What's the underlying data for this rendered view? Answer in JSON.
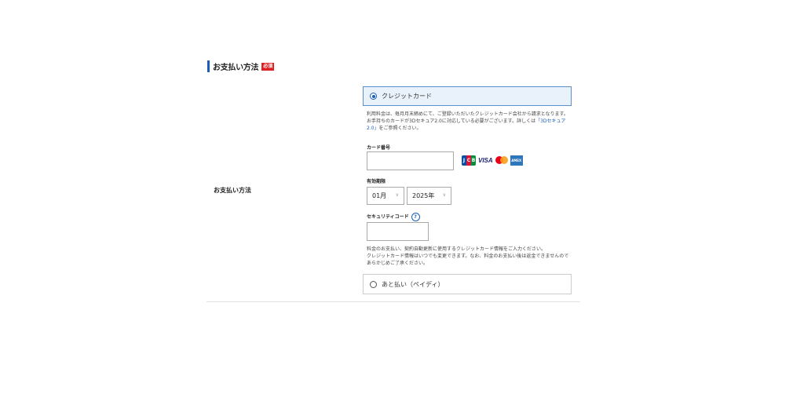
{
  "section": {
    "title": "お支払い方法",
    "required_badge": "必須"
  },
  "row_label": "お支払い方法",
  "credit_option": {
    "label": "クレジットカード",
    "selected": true
  },
  "note_top": {
    "line1": "利用料金は、毎月月末締めにて、ご登録いただいたクレジットカード会社から請求となります。",
    "line2_prefix": "お手持ちのカードが3Dセキュア2.0に対応している必要がございます。詳しくは",
    "link": "「3Dセキュア2.0」",
    "line2_suffix": "をご参照ください。"
  },
  "card_number": {
    "label": "カード番号",
    "value": "",
    "placeholder": ""
  },
  "card_brands": [
    {
      "name": "JCB",
      "icon": "jcb-icon"
    },
    {
      "name": "VISA",
      "icon": "visa-icon"
    },
    {
      "name": "Mastercard",
      "icon": "mastercard-icon"
    },
    {
      "name": "AMEX",
      "icon": "amex-icon"
    }
  ],
  "expiry": {
    "label": "有効期限",
    "month": "01月",
    "year": "2025年"
  },
  "security_code": {
    "label": "セキュリティコード",
    "help": "?",
    "value": ""
  },
  "note_bottom": {
    "line1": "料金のお支払い、契約自動更新に使用するクレジットカード情報をご入力ください。",
    "line2": "クレジットカード情報はいつでも変更できます。なお、料金のお支払い後は返金できませんのであらかじめご了承ください。"
  },
  "paidy_option": {
    "label": "あと払い（ペイディ）",
    "selected": false
  },
  "colors": {
    "accent": "#1a5fb4",
    "required": "#e02020",
    "selected_bg": "#e9f1fb"
  }
}
